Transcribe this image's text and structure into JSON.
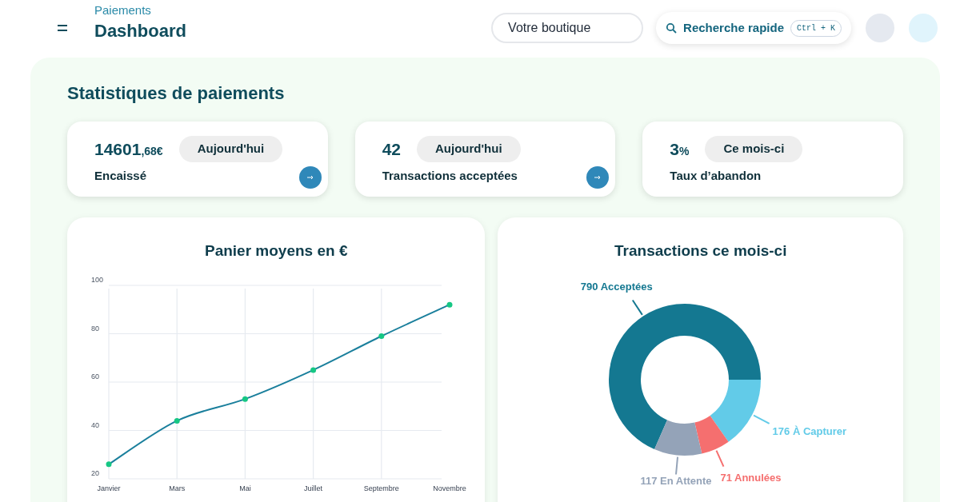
{
  "header": {
    "breadcrumb": "Paiements",
    "title": "Dashboard",
    "shop_field": {
      "value": "Votre boutique"
    },
    "search_button": {
      "label": "Recherche rapide",
      "shortcut": "Ctrl + K"
    }
  },
  "section_title": "Statistiques de paiements",
  "stat_cards": [
    {
      "value": "14601",
      "value_suffix": ",68€",
      "period": "Aujourd'hui",
      "label": "Encaissé",
      "link": true
    },
    {
      "value": "42",
      "period": "Aujourd'hui",
      "label": "Transactions acceptées",
      "link": true
    },
    {
      "value": "3",
      "value_suffix": "%",
      "period": "Ce mois-ci",
      "label": "Taux d’abandon",
      "link": false
    }
  ],
  "basket_chart": {
    "title": "Panier moyens en €",
    "chart_data": {
      "type": "line",
      "categories": [
        "Janvier",
        "Mars",
        "Mai",
        "Juillet",
        "Septembre",
        "Novembre"
      ],
      "series": [
        {
          "color": "#1a7f9c",
          "marker": true,
          "values": [
            26,
            44,
            53,
            65,
            79,
            92
          ]
        }
      ],
      "grid": true,
      "ylim": [
        20,
        100
      ],
      "yticks": [
        20,
        40,
        60,
        80,
        100
      ]
    }
  },
  "transactions_chart": {
    "title": "Transactions ce mois-ci",
    "chart_data": {
      "type": "donut",
      "categories": [
        "790 Acceptées",
        "176 À Capturer",
        "71 Annulées",
        "117 En Attente"
      ],
      "values": [
        790,
        176,
        71,
        117
      ],
      "colors": [
        "#147891",
        "#62cbe8",
        "#f56f6f",
        "#94a3b8"
      ]
    }
  }
}
